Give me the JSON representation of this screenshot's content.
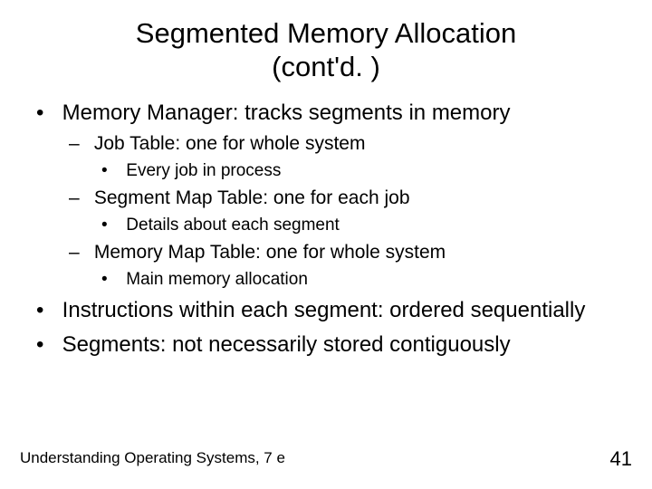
{
  "title_line1": "Segmented Memory Allocation",
  "title_line2": "(cont'd. )",
  "bullets": {
    "b1": "Memory Manager: tracks segments in memory",
    "b1a": "Job Table: one for whole system",
    "b1a1": "Every job in process",
    "b1b": "Segment Map Table: one for each job",
    "b1b1": "Details about each segment",
    "b1c": "Memory Map Table: one for whole system",
    "b1c1": "Main memory allocation",
    "b2": "Instructions within each segment: ordered sequentially",
    "b3": "Segments: not necessarily stored contiguously"
  },
  "footer": {
    "left": "Understanding Operating Systems, 7 e",
    "page": "41"
  }
}
